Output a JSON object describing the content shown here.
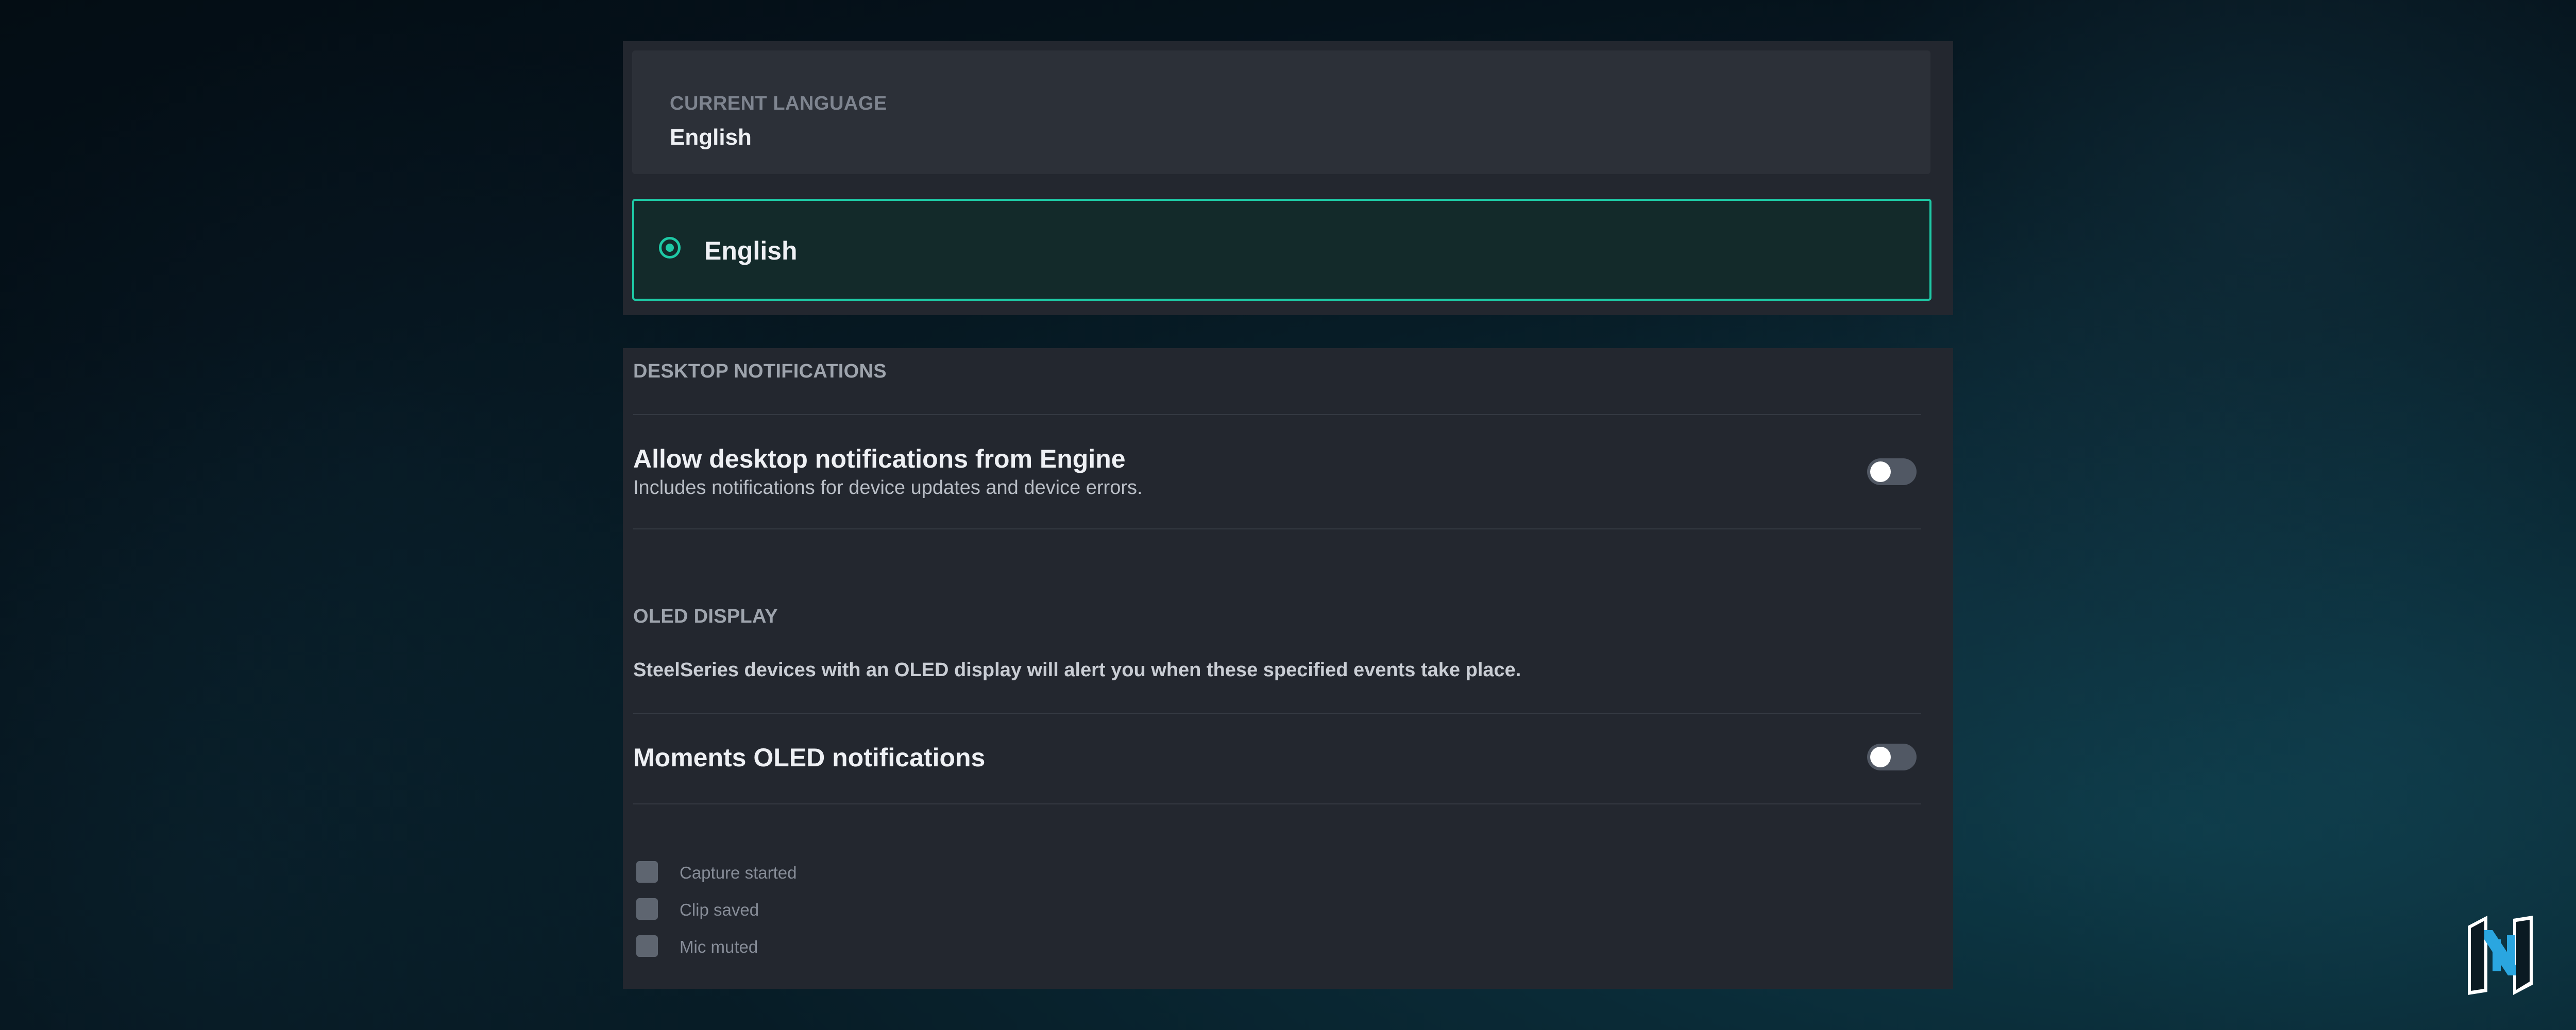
{
  "language": {
    "current_label": "CURRENT LANGUAGE",
    "current_value": "English",
    "options": [
      {
        "label": "English",
        "selected": true
      }
    ]
  },
  "desktop_notifications": {
    "header": "DESKTOP NOTIFICATIONS",
    "allow": {
      "title": "Allow desktop notifications from Engine",
      "description": "Includes notifications for device updates and device errors.",
      "enabled": false
    }
  },
  "oled_display": {
    "header": "OLED DISPLAY",
    "description": "SteelSeries devices with an OLED display will alert you when these specified events take place.",
    "moments": {
      "title": "Moments OLED notifications",
      "enabled": false
    },
    "events": [
      {
        "label": "Capture started",
        "checked": false
      },
      {
        "label": "Clip saved",
        "checked": false
      },
      {
        "label": "Mic muted",
        "checked": false
      }
    ]
  },
  "colors": {
    "accent": "#1ec9a5",
    "panel": "#23272f",
    "toggle_off": "#515864"
  },
  "icons": {
    "logo": "brand-n-logo-icon"
  }
}
